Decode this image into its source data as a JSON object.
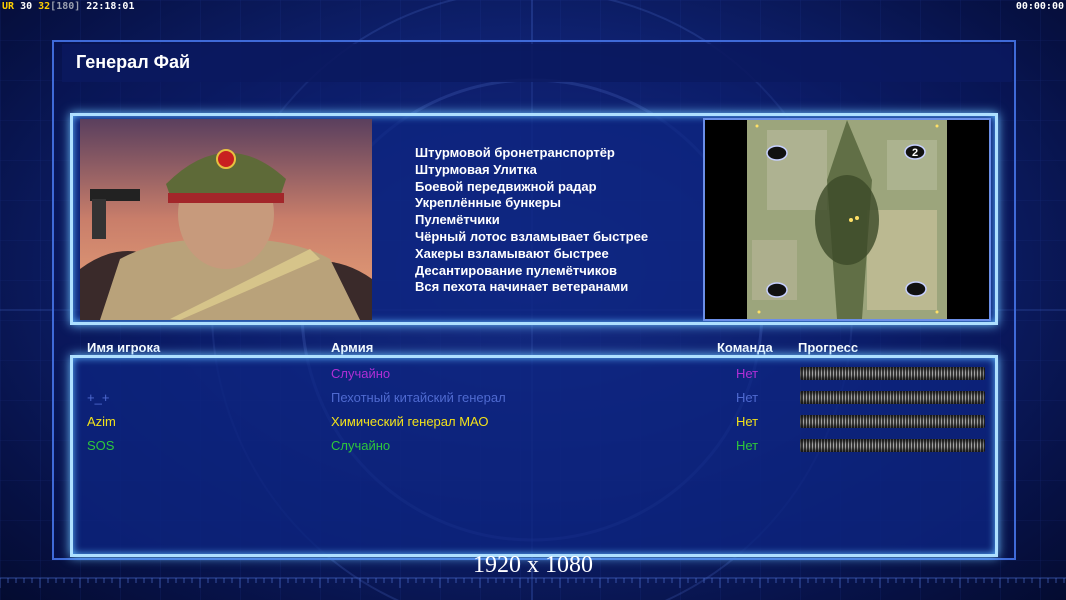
{
  "hud": {
    "left_segments": [
      {
        "text": "UR",
        "color": "#ffd000"
      },
      {
        "text": " 30",
        "color": "#ffffff"
      },
      {
        "text": " 32",
        "color": "#ffd000"
      },
      {
        "text": "[180]",
        "color": "#9aa0b0"
      },
      {
        "text": " 22:18:01",
        "color": "#ffffff"
      }
    ],
    "timer": "00:00:00"
  },
  "general": {
    "title": "Генерал Фай",
    "units": [
      "Штурмовой бронетранспортёр",
      "Штурмовая Улитка",
      "Боевой передвижной радар",
      "Укреплённые бункеры",
      "Пулемётчики",
      "Чёрный лотос взламывает быстрее",
      "Хакеры взламывают быстрее",
      "Десантирование пулемётчиков",
      "Вся пехота начинает ветеранами"
    ]
  },
  "minimap": {
    "selected_slot_label": "2"
  },
  "players": {
    "headers": {
      "name": "Имя игрока",
      "army": "Армия",
      "team": "Команда",
      "progress": "Прогресс"
    },
    "rows": [
      {
        "name": "",
        "army": "Случайно",
        "team": "Нет",
        "color": "#b02fd6"
      },
      {
        "name": "+_+",
        "army": "Пехотный китайский генерал",
        "team": "Нет",
        "color": "#4f6ad0"
      },
      {
        "name": "Azim",
        "army": "Химический генерал МАО",
        "team": "Нет",
        "color": "#f2e21a"
      },
      {
        "name": "SOS",
        "army": "Случайно",
        "team": "Нет",
        "color": "#2ec83a"
      }
    ]
  },
  "resolution": "1920 x 1080"
}
